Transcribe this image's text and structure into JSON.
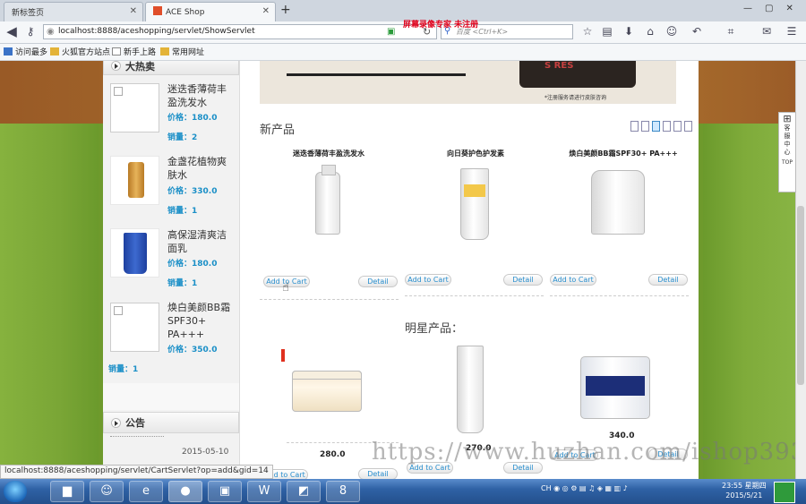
{
  "browser": {
    "tabs": [
      {
        "label": "新标签页",
        "active": false
      },
      {
        "label": "ACE Shop",
        "active": true
      }
    ],
    "new_tab_label": "+",
    "url": "localhost:8888/aceshopping/servlet/ShowServlet",
    "search_placeholder": "百度 <Ctrl+K>",
    "recording_note": "屏幕录像专家 未注册",
    "bookmarks": [
      "访问最多",
      "火狐官方站点",
      "新手上路",
      "常用网址"
    ]
  },
  "sidebar": {
    "hot_title": "大热卖",
    "price_label": "价格：",
    "sold_label": "销量：",
    "items": [
      {
        "name": "迷迭香薄荷丰盈洗发水",
        "price": "180.0",
        "sold": "2",
        "thumb": "placeholder"
      },
      {
        "name": "金盏花植物爽肤水",
        "price": "330.0",
        "sold": "1",
        "thumb": "amber-bottle"
      },
      {
        "name": "高保湿清爽洁面乳",
        "price": "180.0",
        "sold": "1",
        "thumb": "blue-tube"
      },
      {
        "name": "焕白美颜BB霜SPF30+ PA+++",
        "price": "350.0",
        "sold": "1",
        "thumb": "placeholder"
      }
    ],
    "notice_title": "公告",
    "notice_date": "2015-05-10"
  },
  "main": {
    "banner_note": "*注册服务请进行皮肤咨询",
    "banner_tag": "S RES",
    "new_title": "新产品",
    "star_title": "明星产品：",
    "add_label": "Add to Cart",
    "detail_label": "Detail",
    "new_products": [
      {
        "name": "迷迭香薄荷丰盈洗发水"
      },
      {
        "name": "向日葵护色护发素"
      },
      {
        "name": "焕白美颜BB霜SPF30+ PA+++"
      }
    ],
    "star_products": [
      {
        "price": "280.0"
      },
      {
        "price": "270.0"
      },
      {
        "price": "340.0"
      }
    ]
  },
  "status_url": "localhost:8888/aceshopping/servlet/CartServlet?op=add&gid=14",
  "watermark": "https://www.huzhan.com/ishop39397",
  "side_widget": {
    "text": "客服中心",
    "top": "TOP"
  },
  "taskbar": {
    "time": "23:55 星期四",
    "date": "2015/5/21",
    "tray_lang": "CH"
  }
}
